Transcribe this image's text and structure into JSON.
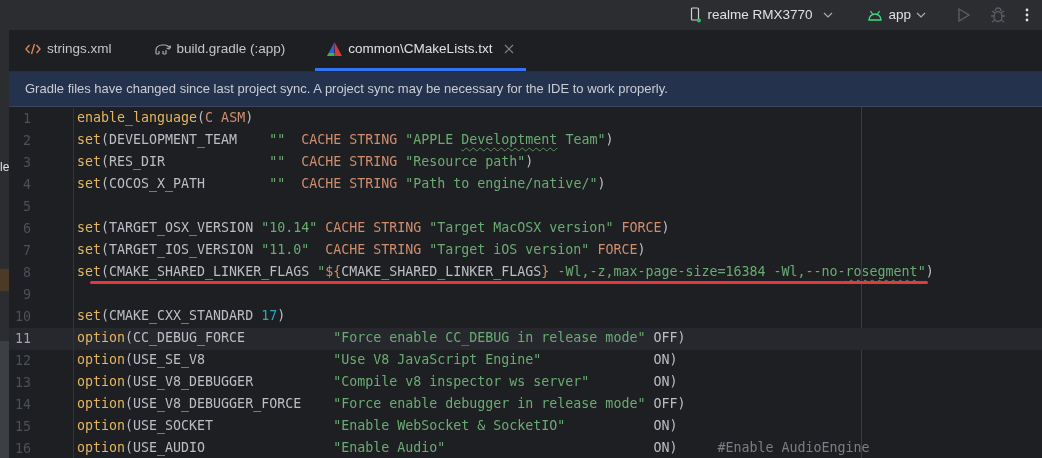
{
  "toolbar": {
    "device": {
      "label": "realme RMX3770",
      "online": true
    },
    "config": {
      "label": "app"
    },
    "run_button": {
      "disabled": true
    },
    "debug_button": {
      "disabled": true
    }
  },
  "side_panel": {
    "text": "le"
  },
  "tabs": [
    {
      "label": "strings.xml",
      "kind": "xml",
      "selected": false,
      "closable": false
    },
    {
      "label": "build.gradle (:app)",
      "kind": "gradle",
      "selected": false,
      "closable": false
    },
    {
      "label": "common\\CMakeLists.txt",
      "kind": "cmake",
      "selected": true,
      "closable": true
    }
  ],
  "banner": {
    "text": "Gradle files have changed since last project sync. A project sync may be necessary for the IDE to work properly."
  },
  "editor": {
    "lines": [
      {
        "number": "1",
        "current": false,
        "annotated": false,
        "tokens": [
          {
            "t": "enable_language",
            "kind": "fn"
          },
          {
            "t": "(",
            "kind": "p"
          },
          {
            "t": "C ASM",
            "kind": "k"
          },
          {
            "t": ")",
            "kind": "p"
          }
        ]
      },
      {
        "number": "2",
        "current": false,
        "annotated": false,
        "tokens": [
          {
            "t": "set",
            "kind": "fn"
          },
          {
            "t": "(DEVELOPMENT_TEAM    ",
            "kind": "p"
          },
          {
            "t": "\"\"  ",
            "kind": "s"
          },
          {
            "t": "CACHE STRING ",
            "kind": "k"
          },
          {
            "t": "\"APPLE ",
            "kind": "s"
          },
          {
            "t": "Developtment",
            "kind": "s",
            "typo": true
          },
          {
            "t": " Team\"",
            "kind": "s"
          },
          {
            "t": ")",
            "kind": "p"
          }
        ]
      },
      {
        "number": "3",
        "current": false,
        "annotated": false,
        "tokens": [
          {
            "t": "set",
            "kind": "fn"
          },
          {
            "t": "(RES_DIR             ",
            "kind": "p"
          },
          {
            "t": "\"\"  ",
            "kind": "s"
          },
          {
            "t": "CACHE STRING ",
            "kind": "k"
          },
          {
            "t": "\"Resource path\"",
            "kind": "s"
          },
          {
            "t": ")",
            "kind": "p"
          }
        ]
      },
      {
        "number": "4",
        "current": false,
        "annotated": false,
        "tokens": [
          {
            "t": "set",
            "kind": "fn"
          },
          {
            "t": "(COCOS_X_PATH        ",
            "kind": "p"
          },
          {
            "t": "\"\"  ",
            "kind": "s"
          },
          {
            "t": "CACHE STRING ",
            "kind": "k"
          },
          {
            "t": "\"Path to engine/native/\"",
            "kind": "s"
          },
          {
            "t": ")",
            "kind": "p"
          }
        ]
      },
      {
        "number": "5",
        "current": false,
        "annotated": false
      },
      {
        "number": "6",
        "current": false,
        "annotated": false,
        "tokens": [
          {
            "t": "set",
            "kind": "fn"
          },
          {
            "t": "(TARGET_OSX_VERSION ",
            "kind": "p"
          },
          {
            "t": "\"10.14\" ",
            "kind": "s"
          },
          {
            "t": "CACHE STRING ",
            "kind": "k"
          },
          {
            "t": "\"Target MacOSX version\" ",
            "kind": "s"
          },
          {
            "t": "FORCE",
            "kind": "k"
          },
          {
            "t": ")",
            "kind": "p"
          }
        ]
      },
      {
        "number": "7",
        "current": false,
        "annotated": false,
        "tokens": [
          {
            "t": "set",
            "kind": "fn"
          },
          {
            "t": "(TARGET_IOS_VERSION ",
            "kind": "p"
          },
          {
            "t": "\"11.0\"  ",
            "kind": "s"
          },
          {
            "t": "CACHE STRING ",
            "kind": "k"
          },
          {
            "t": "\"Target iOS version\" ",
            "kind": "s"
          },
          {
            "t": "FORCE",
            "kind": "k"
          },
          {
            "t": ")",
            "kind": "p"
          }
        ]
      },
      {
        "number": "8",
        "current": false,
        "annotated": true,
        "tokens": [
          {
            "t": "set",
            "kind": "fn"
          },
          {
            "t": "(CMAKE_SHARED_LINKER_FLAGS ",
            "kind": "p"
          },
          {
            "t": "\"",
            "kind": "s"
          },
          {
            "t": "${",
            "kind": "k"
          },
          {
            "t": "CMAKE_SHARED_LINKER_FLAGS",
            "kind": "p"
          },
          {
            "t": "}",
            "kind": "k"
          },
          {
            "t": " -Wl,-z,max-page-size=16384 -Wl,--no-",
            "kind": "s"
          },
          {
            "t": "rosegment",
            "kind": "s",
            "typo": true
          },
          {
            "t": "\"",
            "kind": "s"
          },
          {
            "t": ")",
            "kind": "p"
          }
        ]
      },
      {
        "number": "9",
        "current": false,
        "annotated": false
      },
      {
        "number": "10",
        "current": false,
        "annotated": false,
        "tokens": [
          {
            "t": "set",
            "kind": "fn"
          },
          {
            "t": "(CMAKE_CXX_STANDARD ",
            "kind": "p"
          },
          {
            "t": "17",
            "kind": "n"
          },
          {
            "t": ")",
            "kind": "p"
          }
        ]
      },
      {
        "number": "11",
        "current": true,
        "annotated": false,
        "tokens": [
          {
            "t": "option",
            "kind": "fn"
          },
          {
            "t": "(CC_DEBUG_FORCE           ",
            "kind": "p"
          },
          {
            "t": "\"Force enable CC_DEBUG in release mode\"",
            "kind": "s"
          },
          {
            "t": " OFF)",
            "kind": "p"
          }
        ]
      },
      {
        "number": "12",
        "current": false,
        "annotated": false,
        "tokens": [
          {
            "t": "option",
            "kind": "fn"
          },
          {
            "t": "(USE_SE_V8                ",
            "kind": "p"
          },
          {
            "t": "\"Use V8 JavaScript Engine\"",
            "kind": "s"
          },
          {
            "t": "              ON)",
            "kind": "p"
          }
        ]
      },
      {
        "number": "13",
        "current": false,
        "annotated": false,
        "tokens": [
          {
            "t": "option",
            "kind": "fn"
          },
          {
            "t": "(USE_V8_DEBUGGER          ",
            "kind": "p"
          },
          {
            "t": "\"Compile v8 inspector ws server\"",
            "kind": "s"
          },
          {
            "t": "        ON)",
            "kind": "p"
          }
        ]
      },
      {
        "number": "14",
        "current": false,
        "annotated": false,
        "tokens": [
          {
            "t": "option",
            "kind": "fn"
          },
          {
            "t": "(USE_V8_DEBUGGER_FORCE    ",
            "kind": "p"
          },
          {
            "t": "\"Force enable debugger in release mode\"",
            "kind": "s"
          },
          {
            "t": " OFF)",
            "kind": "p"
          }
        ]
      },
      {
        "number": "15",
        "current": false,
        "annotated": false,
        "tokens": [
          {
            "t": "option",
            "kind": "fn"
          },
          {
            "t": "(USE_SOCKET               ",
            "kind": "p"
          },
          {
            "t": "\"Enable WebSocket & SocketIO\"",
            "kind": "s"
          },
          {
            "t": "           ON)",
            "kind": "p"
          }
        ]
      },
      {
        "number": "16",
        "current": false,
        "annotated": false,
        "tokens": [
          {
            "t": "option",
            "kind": "fn"
          },
          {
            "t": "(USE_AUDIO                ",
            "kind": "p"
          },
          {
            "t": "\"Enable Audio\"",
            "kind": "s"
          },
          {
            "t": "                          ON)     ",
            "kind": "p"
          },
          {
            "t": "#Enable AudioEngine",
            "kind": "c"
          }
        ]
      }
    ]
  }
}
